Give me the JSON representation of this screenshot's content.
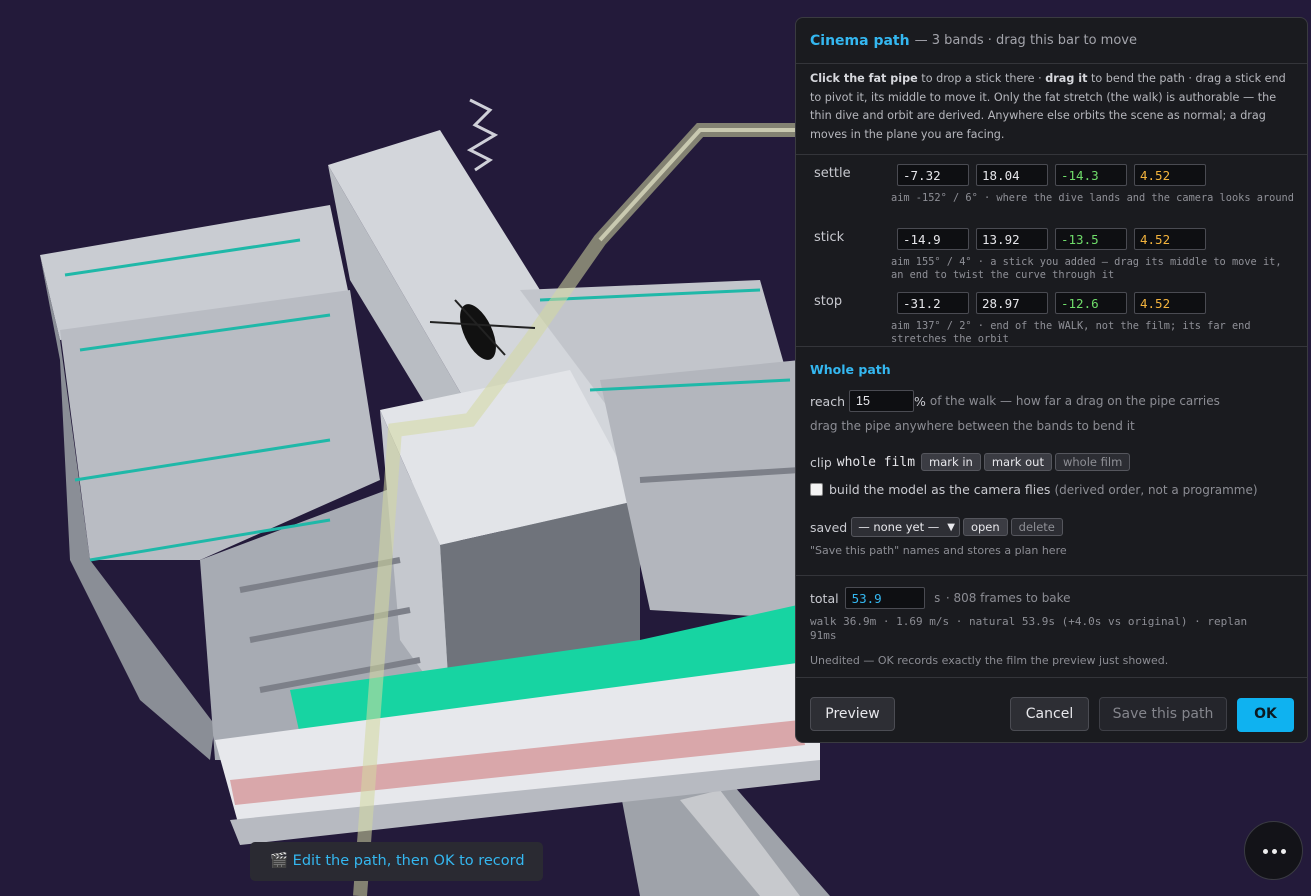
{
  "panel": {
    "title": "Cinema path",
    "subtitle": "— 3 bands · drag this bar to move",
    "help": {
      "b1": "Click the fat pipe",
      "t1": " to drop a stick there · ",
      "b2": "drag it",
      "t2": " to bend the path · drag a stick end to pivot it, its middle to move it. Only the fat stretch (the walk) is authorable — the thin dive and orbit are derived. Anywhere else orbits the scene as normal; a drag moves in the plane you are facing."
    },
    "bands": [
      {
        "label": "settle",
        "values": [
          "-7.32",
          "18.04",
          "-14.3",
          "4.52"
        ],
        "desc": "aim -152° / 6° · where the dive lands and the camera looks around"
      },
      {
        "label": "stick",
        "values": [
          "-14.9",
          "13.92",
          "-13.5",
          "4.52"
        ],
        "desc": "aim 155° / 4° · a stick you added — drag its middle to move it, an end to twist the curve through it"
      },
      {
        "label": "stop",
        "values": [
          "-31.2",
          "28.97",
          "-12.6",
          "4.52"
        ],
        "desc": "aim 137° / 2° · end of the WALK, not the film; its far end stretches the orbit"
      }
    ],
    "whole": {
      "heading": "Whole path",
      "reach_label": "reach",
      "reach_value": "15",
      "reach_pct": "%",
      "reach_note": "of the walk — how far a drag on the pipe carries",
      "drag_note": "drag the pipe anywhere between the bands to bend it",
      "clip_label": "clip",
      "clip_value": "whole film",
      "mark_in": "mark in",
      "mark_out": "mark out",
      "whole_film": "whole film",
      "build_label": "build the model as the camera flies",
      "build_note": "(derived order, not a programme)",
      "build_checked": false,
      "saved_label": "saved",
      "saved_option": "— none yet —",
      "open": "open",
      "delete": "delete",
      "saved_note": "\"Save this path\" names and stores a plan here"
    },
    "total": {
      "label": "total",
      "value": "53.9",
      "unit": "s",
      "frames": "· 808 frames to bake",
      "stats": "walk 36.9m · 1.69 m/s · natural 53.9s (+4.0s vs original) · replan 91ms",
      "status": "Unedited — OK records exactly the film the preview just showed."
    },
    "buttons": {
      "preview": "Preview",
      "cancel": "Cancel",
      "save": "Save this path",
      "ok": "OK"
    }
  },
  "toast": {
    "icon": "🎬",
    "text": "Edit the path, then OK to record"
  },
  "fab": {
    "icon": "more-icon"
  }
}
